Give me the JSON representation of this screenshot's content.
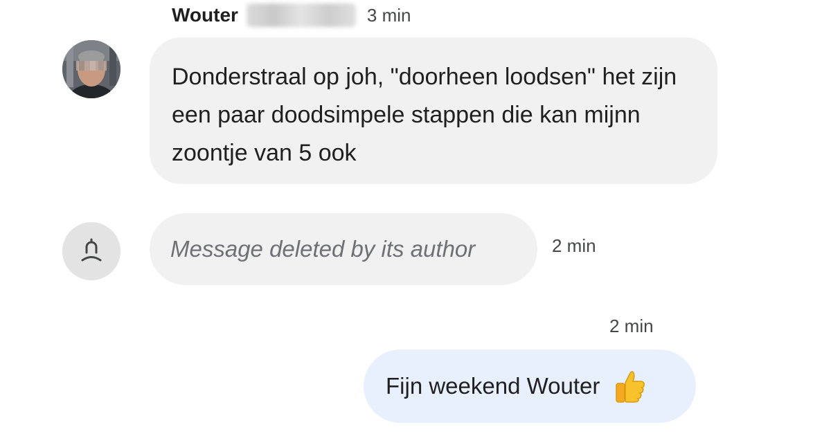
{
  "thread": {
    "header": {
      "sender_name": "Wouter",
      "time": "3 min"
    },
    "messages": [
      {
        "direction": "incoming",
        "text": "Donderstraal op joh, \"doorheen loodsen\" het zijn een paar doodsimpele stappen die kan mijnn zoontje van 5 ook"
      },
      {
        "direction": "incoming",
        "deleted": true,
        "text": "Message deleted by its author",
        "time": "2 min"
      },
      {
        "direction": "outgoing",
        "time": "2 min",
        "text": "Fijn weekend Wouter",
        "emoji": "thumbs-up"
      }
    ]
  },
  "colors": {
    "incoming_bubble": "#f1f1f1",
    "outgoing_bubble": "#e8f0fd",
    "text": "#1f1f1f",
    "meta_text": "#444746",
    "deleted_text": "#6f7074"
  },
  "icons": {
    "placeholder_avatar": "person-outline-icon",
    "emoji": "thumbs-up-icon"
  }
}
